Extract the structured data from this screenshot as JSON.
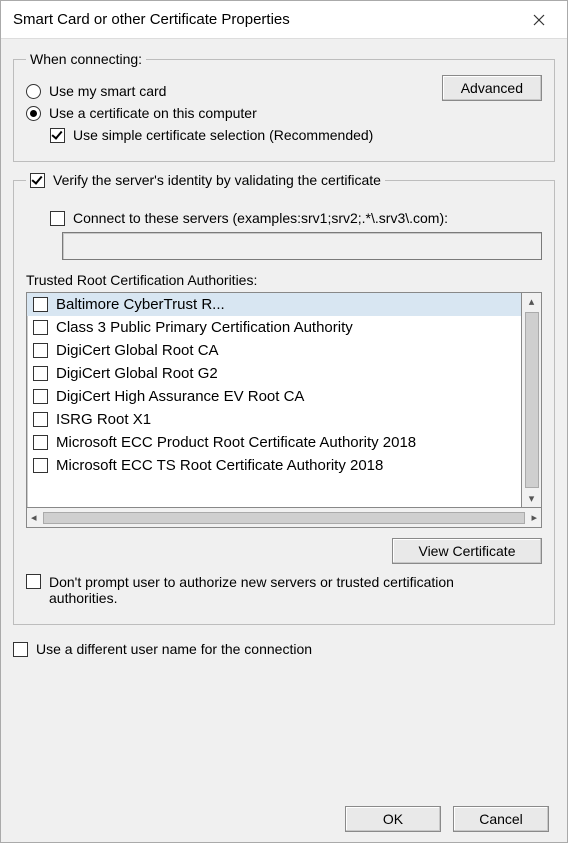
{
  "title": "Smart Card or other Certificate Properties",
  "connecting": {
    "legend": "When connecting:",
    "use_smart_card": "Use my smart card",
    "use_cert": "Use a certificate on this computer",
    "simple_selection": "Use simple certificate selection (Recommended)",
    "advanced_btn": "Advanced"
  },
  "verify": {
    "verify_label": "Verify the server's identity by validating the certificate",
    "connect_servers_label": "Connect to these servers (examples:srv1;srv2;.*\\.srv3\\.com):",
    "servers_value": "",
    "ca_label": "Trusted Root Certification Authorities:",
    "ca_items": [
      "Baltimore CyberTrust R...",
      "Class 3 Public Primary Certification Authority",
      "DigiCert Global Root CA",
      "DigiCert Global Root G2",
      "DigiCert High Assurance EV Root CA",
      "ISRG Root X1",
      "Microsoft ECC Product Root Certificate Authority 2018",
      "Microsoft ECC TS Root Certificate Authority 2018"
    ],
    "view_cert_btn": "View Certificate",
    "dont_prompt": "Don't prompt user to authorize new servers or trusted certification authorities."
  },
  "diff_user": "Use a different user name for the connection",
  "buttons": {
    "ok": "OK",
    "cancel": "Cancel"
  }
}
